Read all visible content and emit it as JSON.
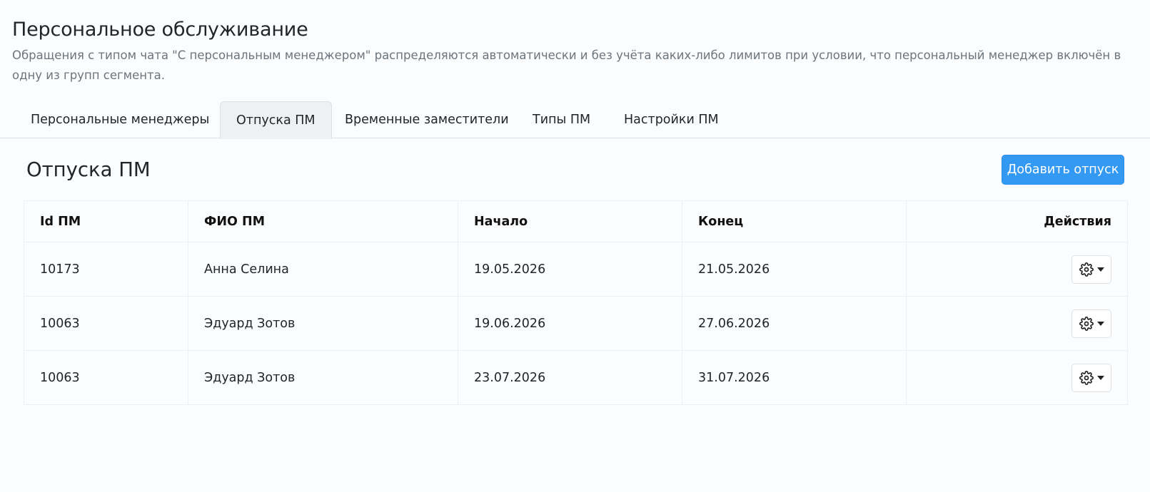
{
  "header": {
    "title": "Персональное обслуживание",
    "description": "Обращения с типом чата \"С персональным менеджером\" распределяются автоматически и без учёта каких-либо лимитов при условии, что персональный менеджер включён в одну из групп сегмента."
  },
  "tabs": [
    {
      "label": "Персональные менеджеры",
      "active": false
    },
    {
      "label": "Отпуска ПМ",
      "active": true
    },
    {
      "label": "Временные заместители",
      "active": false
    },
    {
      "label": "Типы ПМ",
      "active": false
    },
    {
      "label": "Настройки ПМ",
      "active": false
    }
  ],
  "section": {
    "title": "Отпуска ПМ",
    "add_button_label": "Добавить отпуск"
  },
  "table": {
    "columns": [
      "Id ПМ",
      "ФИО ПМ",
      "Начало",
      "Конец",
      "Действия"
    ],
    "rows": [
      {
        "id": "10173",
        "name": "Анна Селина",
        "start": "19.05.2026",
        "end": "21.05.2026",
        "action_icon": "gear-icon"
      },
      {
        "id": "10063",
        "name": "Эдуард Зотов",
        "start": "19.06.2026",
        "end": "27.06.2026",
        "action_icon": "gear-icon"
      },
      {
        "id": "10063",
        "name": "Эдуард Зотов",
        "start": "23.07.2026",
        "end": "31.07.2026",
        "action_icon": "gear-icon"
      }
    ]
  },
  "colors": {
    "accent": "#3399f3",
    "background": "#fbfcfd",
    "muted_text": "#6c757d"
  }
}
